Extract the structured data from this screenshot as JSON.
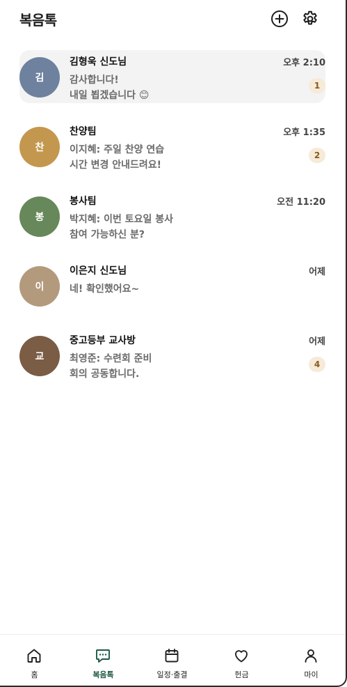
{
  "header": {
    "title": "복음톡",
    "add_icon": "plus-circle-icon",
    "settings_icon": "gear-icon"
  },
  "chats": [
    {
      "initial": "김",
      "name": "김형욱 신도님",
      "time": "오후 2:10",
      "preview": [
        "감사합니다!",
        "내일 뵙겠습니다 😊"
      ],
      "unread": "1",
      "avatar_color": "#6e819e",
      "active": true
    },
    {
      "initial": "찬",
      "name": "찬양팀",
      "time": "오후 1:35",
      "preview": [
        "이지혜: 주일 찬양 연습",
        "시간 변경 안내드려요!"
      ],
      "unread": "2",
      "avatar_color": "#c4974e",
      "active": false
    },
    {
      "initial": "봉",
      "name": "봉사팀",
      "time": "오전 11:20",
      "preview": [
        "박지혜: 이번 토요일 봉사",
        "참여 가능하신 분?"
      ],
      "unread": "",
      "avatar_color": "#67885a",
      "active": false
    },
    {
      "initial": "이",
      "name": "이은지 신도님",
      "time": "어제",
      "preview": [
        "네! 확인했어요~",
        ""
      ],
      "unread": "",
      "avatar_color": "#b39a7c",
      "active": false
    },
    {
      "initial": "교",
      "name": "중고등부 교사방",
      "time": "어제",
      "preview": [
        "최영준: 수련회 준비",
        "회의 공동합니다."
      ],
      "unread": "4",
      "avatar_color": "#7b5c45",
      "active": false
    }
  ],
  "nav": {
    "active": "chat",
    "items": [
      {
        "id": "home",
        "label": "홈",
        "icon": "home-icon"
      },
      {
        "id": "chat",
        "label": "복음톡",
        "icon": "chat-bubble-icon"
      },
      {
        "id": "schedule",
        "label": "일정·출결",
        "icon": "calendar-icon"
      },
      {
        "id": "offering",
        "label": "헌금",
        "icon": "heart-icon"
      },
      {
        "id": "my",
        "label": "마이",
        "icon": "user-icon"
      }
    ]
  },
  "colors": {
    "accent": "#1e5a43",
    "badge_bg": "#f6ead8",
    "badge_text": "#8a5a1e",
    "active_row": "#f3f3f3"
  }
}
